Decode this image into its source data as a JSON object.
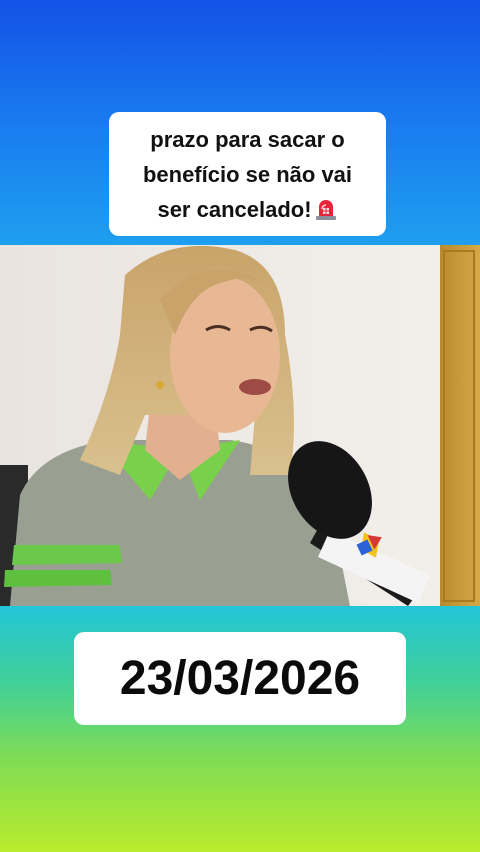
{
  "caption": {
    "lines": [
      "prazo para sacar o",
      "benefício se não vai",
      "ser cancelado!"
    ],
    "emoji_icon": "police-siren-icon"
  },
  "date_card": {
    "text": "23/03/2026"
  },
  "video": {
    "description_icon": "video-frame"
  },
  "colors": {
    "top_gradient": "#1352e6",
    "bottom_gradient": "#b9ec2c",
    "card_background": "#ffffff",
    "text": "#111111"
  }
}
